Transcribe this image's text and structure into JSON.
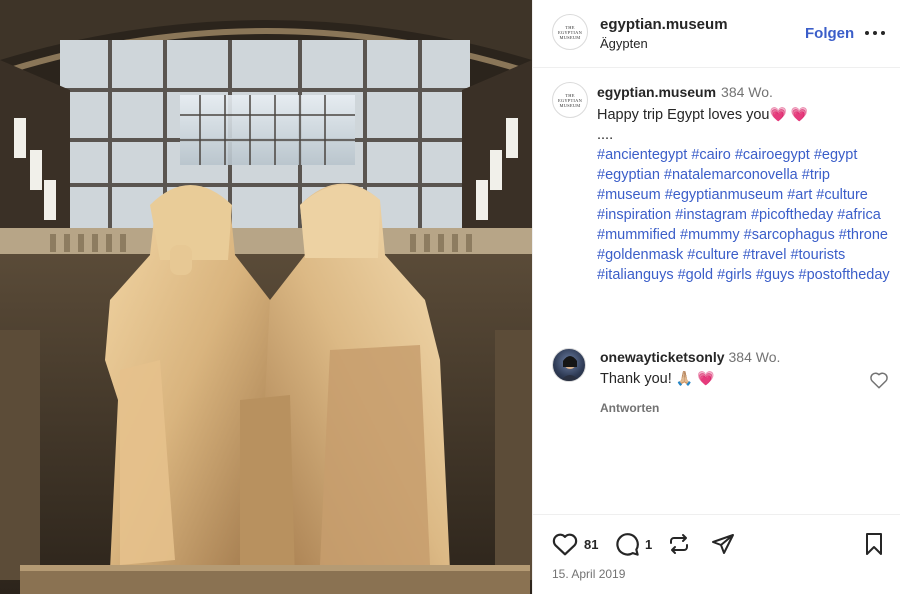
{
  "post": {
    "username": "egyptian.museum",
    "location": "Ägypten",
    "follow_label": "Folgen",
    "avatar_text": "THE EGYPTIAN MUSEUM",
    "photo_alt": "Colossal seated statue of Amenhotep III and Queen Tiye in the Egyptian Museum atrium"
  },
  "caption": {
    "username": "egyptian.museum",
    "time": "384 Wo.",
    "text": "Happy trip Egypt loves you",
    "emoji": "💗 💗",
    "dots": "....",
    "hashtags": [
      "#ancientegypt",
      "#cairo",
      "#cairoegypt",
      "#egypt",
      "#egyptian",
      "#natalemarconovella",
      "#trip",
      "#museum",
      "#egyptianmuseum",
      "#art",
      "#culture",
      "#inspiration",
      "#instagram",
      "#picoftheday",
      "#africa",
      "#mummified",
      "#mummy",
      "#sarcophagus",
      "#throne",
      "#goldenmask",
      "#culture",
      "#travel",
      "#tourists",
      "#italianguys",
      "#gold",
      "#girls",
      "#guys",
      "#postoftheday"
    ]
  },
  "comment": {
    "username": "onewayticketsonly",
    "time": "384 Wo.",
    "text": "Thank you!",
    "emoji": "🙏🏼 💗",
    "reply_label": "Antworten"
  },
  "actions": {
    "likes": "81",
    "comments": "1",
    "date": "15. April 2019"
  },
  "colors": {
    "link": "#3b5ec9",
    "text": "#262626",
    "muted": "#737373",
    "heart": "#e8336b"
  }
}
